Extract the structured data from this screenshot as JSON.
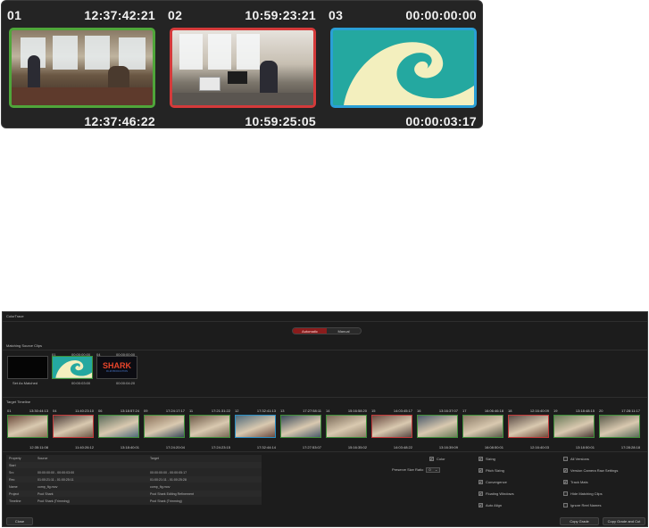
{
  "clip_strip": {
    "clips": [
      {
        "num": "01",
        "tc_in": "12:37:42:21",
        "tc_out": "12:37:46:22",
        "border": "#4fa63a"
      },
      {
        "num": "02",
        "tc_in": "10:59:23:21",
        "tc_out": "10:59:25:05",
        "border": "#d43a3a"
      },
      {
        "num": "03",
        "tc_in": "00:00:00:00",
        "tc_out": "00:00:03:17",
        "border": "#2a9fd6"
      }
    ]
  },
  "panel": {
    "title": "ColorTrace",
    "modes": {
      "automatic": "Automatic",
      "manual": "Manual"
    },
    "matching_label": "Matching Source Clips",
    "target_label": "Target Timeline",
    "source_clips": [
      {
        "num": "",
        "tc_a": "",
        "tc_b": "Set As Matched"
      },
      {
        "num": "01",
        "tc_a": "00:00:00:00",
        "tc_b": "00:00:03:00"
      },
      {
        "num": "04",
        "tc_a": "00:00:00:00",
        "tc_b": "00:00:04:20"
      }
    ],
    "shark_text": "SHARK",
    "shark_sub": "FILM PRODUCTION",
    "target_clips": [
      {
        "num": "01",
        "tc_a": "13:30:44:13",
        "tc_b": "12:35:11:08",
        "border": "#3e8f3a"
      },
      {
        "num": "04",
        "tc_a": "11:40:23:10",
        "tc_b": "11:40:26:12",
        "border": "#c33a3a"
      },
      {
        "num": "06",
        "tc_a": "13:18:57:24",
        "tc_b": "13:18:40:01",
        "border": "#3e8f3a"
      },
      {
        "num": "09",
        "tc_a": "17:24:17:17",
        "tc_b": "17:24:20:04",
        "border": "#3e8f3a"
      },
      {
        "num": "11",
        "tc_a": "17:21:31:22",
        "tc_b": "17:24:23:15",
        "border": "#3e8f3a"
      },
      {
        "num": "12",
        "tc_a": "17:32:41:13",
        "tc_b": "17:32:44:14",
        "border": "#2a8fc4"
      },
      {
        "num": "13",
        "tc_a": "17:27:58:11",
        "tc_b": "17:27:53:07",
        "border": "#3e8f3a"
      },
      {
        "num": "14",
        "tc_a": "15:16:58:20",
        "tc_b": "15:16:35:02",
        "border": "#3e8f3a"
      },
      {
        "num": "15",
        "tc_a": "14:03:45:17",
        "tc_b": "14:03:48:22",
        "border": "#c33a3a"
      },
      {
        "num": "16",
        "tc_a": "13:16:37:07",
        "tc_b": "13:16:39:09",
        "border": "#3e8f3a"
      },
      {
        "num": "17",
        "tc_a": "16:06:46:18",
        "tc_b": "16:08:50:01",
        "border": "#3e8f3a"
      },
      {
        "num": "18",
        "tc_a": "12:16:40:09",
        "tc_b": "12:16:40:03",
        "border": "#c33a3a"
      },
      {
        "num": "19",
        "tc_a": "13:18:48:15",
        "tc_b": "13:18:50:01",
        "border": "#3e8f3a"
      },
      {
        "num": "20",
        "tc_a": "17:28:11:17",
        "tc_b": "17:28:28:18",
        "border": "#3e8f3a"
      }
    ],
    "report": {
      "headers": [
        "Property",
        "Source",
        "Target"
      ],
      "rows": [
        [
          "Start",
          "",
          ""
        ],
        [
          "Src",
          "00:00:00:00 - 00:00:03:00",
          "00:00:00:00 - 00:00:05:17"
        ],
        [
          "Rec",
          "01:00:21:11 - 01:00:25:11",
          "01:00:21:11 - 01:00:25:28"
        ],
        [
          "Name",
          "comp_fig.mov",
          "comp_fig.mov"
        ],
        [
          "Project",
          "Pool Shark",
          "Pool Shark Editing Refinement"
        ],
        [
          "Timeline",
          "Pool Shark (Trimming)",
          "Pool Shark (Trimming)"
        ]
      ]
    },
    "options": {
      "color": "Color",
      "preserve_scale": "Preserve Size Ratio",
      "scale_value": "0",
      "col2": [
        "Sizing",
        "Pitch Sizing",
        "Convergence",
        "Floating Windows",
        "Auto Align"
      ],
      "col3": [
        "All Versions",
        "Version Camera Raw Settings",
        "Track Mats",
        "Hide Matching Clips",
        "Ignore Reel Names"
      ],
      "col3_checked": [
        false,
        true,
        true,
        false,
        false
      ]
    },
    "buttons": {
      "close": "Close",
      "copy_grade": "Copy Grade",
      "copy_grade_cut": "Copy Grade and Cut"
    }
  }
}
